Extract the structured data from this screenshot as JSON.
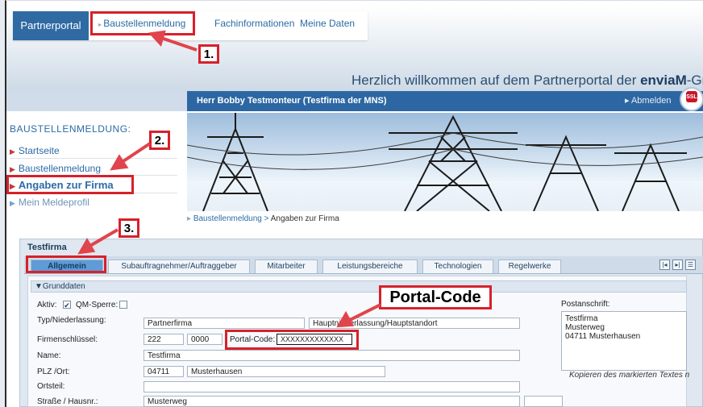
{
  "header": {
    "brand_tab": "Partnerportal",
    "nav_tabs": [
      "Baustellenmeldung",
      "Fachinformationen",
      "Meine Daten"
    ],
    "welcome_prefix": "Herzlich willkommen auf dem Partnerportal der ",
    "welcome_brand": "enviaM",
    "welcome_suffix": "-Gruppe"
  },
  "userbar": {
    "user": "Herr Bobby Testmonteur (Testfirma der MNS)",
    "logout": "▸ Abmelden",
    "ssl_badge": "SSL"
  },
  "sidebar": {
    "title": "BAUSTELLENMELDUNG:",
    "items": [
      {
        "label": "Startseite"
      },
      {
        "label": "Baustellenmeldung"
      },
      {
        "label": "Angaben zur Firma"
      },
      {
        "label": "Mein Meldeprofil"
      }
    ]
  },
  "breadcrumb": {
    "parent": "Baustellenmeldung",
    "separator": " > ",
    "current": "Angaben zur Firma"
  },
  "annotations": {
    "step1": "1.",
    "step2": "2.",
    "step3": "3.",
    "portal_code_callout": "Portal-Code"
  },
  "form": {
    "panel_title": "Testfirma",
    "tabs": [
      "Allgemein",
      "Subauftragnehmer/Auftraggeber",
      "Mitarbeiter",
      "Leistungsbereiche",
      "Technologien",
      "Regelwerke"
    ],
    "section": "▼Grunddaten",
    "aktiv_label": "Aktiv:",
    "qm_label": "QM-Sperre:",
    "typ_label": "Typ/Niederlassung:",
    "typ_value": "Partnerfirma",
    "typ_value2": "Hauptniederlassung/Hauptstandort",
    "schluessel_label": "Firmenschlüssel:",
    "schluessel_value1": "222",
    "schluessel_value2": "0000",
    "portal_code_label": "Portal-Code:",
    "portal_code_value": "XXXXXXXXXXXXX",
    "name_label": "Name:",
    "name_value": "Testfirma",
    "plz_label": "PLZ /Ort:",
    "plz_value": "04711",
    "ort_value": "Musterhausen",
    "ortsteil_label": "Ortsteil:",
    "ortsteil_value": "",
    "strasse_label": "Straße / Hausnr.:",
    "strasse_value": "Musterweg",
    "hausnr_value": "",
    "postanschrift_label": "Postanschrift:",
    "postanschrift_lines": [
      "Testfirma",
      "Musterweg",
      "04711 Musterhausen"
    ],
    "kopieren_hint": "Kopieren des markierten Textes n"
  },
  "colors": {
    "brand_blue": "#2f6aa3",
    "annotation_red": "#d6212b"
  }
}
